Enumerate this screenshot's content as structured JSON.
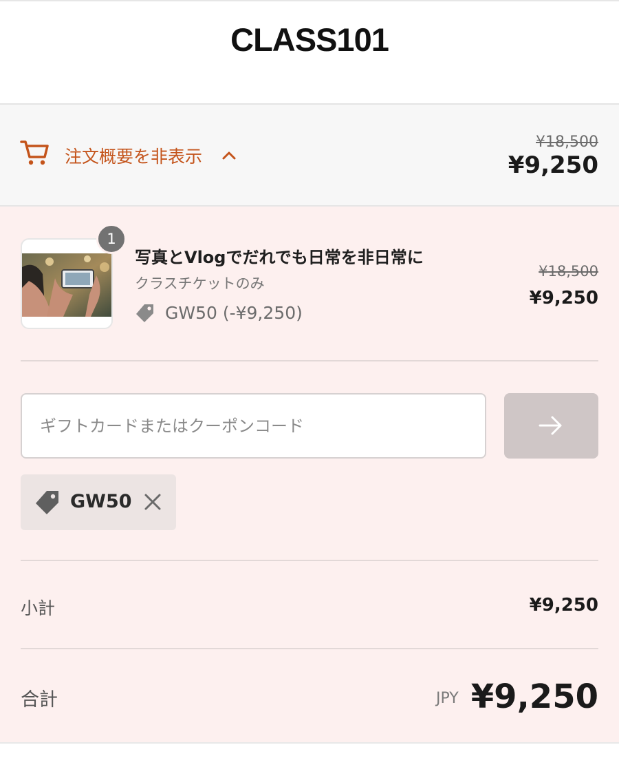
{
  "header": {
    "logo": "CLASS101"
  },
  "summary": {
    "toggle_label": "注文概要を非表示",
    "original_price": "¥18,500",
    "total": "¥9,250"
  },
  "product": {
    "quantity": "1",
    "title": "写真とVlogでだれでも日常を非日常に",
    "subtitle": "クラスチケットのみ",
    "coupon_applied": "GW50 (-¥9,250)",
    "original_price": "¥18,500",
    "price": "¥9,250"
  },
  "coupon": {
    "placeholder": "ギフトカードまたはクーポンコード",
    "value": "",
    "chip_label": "GW50"
  },
  "totals": {
    "subtotal_label": "小計",
    "subtotal_value": "¥9,250",
    "total_label": "合計",
    "currency": "JPY",
    "total_value": "¥9,250"
  },
  "colors": {
    "accent": "#c4541b",
    "panel_bg": "#fdf0ef",
    "summary_bg": "#f7f7f7",
    "apply_button": "#cfc6c6"
  },
  "icons": {
    "cart": "cart-icon",
    "chevron": "chevron-up-icon",
    "tag": "tag-icon",
    "arrow": "arrow-right-icon",
    "remove": "close-icon"
  }
}
